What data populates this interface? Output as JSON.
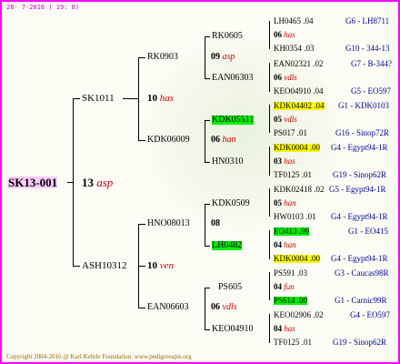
{
  "header": {
    "date": "28- 7-2016 ( 19: 8)"
  },
  "footer": {
    "copyright": "Copyright 2004-2016 @ Karl Kehrle Foundation.   www.pedigreeapis.org"
  },
  "root": {
    "name": "SK13-001",
    "number": "13",
    "year_code": "asp"
  },
  "gen2": [
    {
      "name": "SK1011"
    },
    {
      "name": "ASH10312"
    }
  ],
  "gen2_nums": [
    {
      "number": "10",
      "year_code": "has"
    },
    {
      "number": "10",
      "year_code": "ven"
    }
  ],
  "gen3": [
    {
      "name": "RK0903",
      "number": "09",
      "year_code": "asp"
    },
    {
      "name": "KDK06009",
      "number": "06",
      "year_code": "han"
    },
    {
      "name": "HNO08013",
      "number": "08",
      "year_code": ""
    },
    {
      "name": "EAN06603",
      "number": "06",
      "year_code": "vdls"
    }
  ],
  "gen4": [
    {
      "name": "RK0605",
      "number": "06",
      "year_code": "has"
    },
    {
      "name": "EAN06303",
      "number": "06",
      "year_code": "vdls"
    },
    {
      "name": "KDK05511",
      "number": "05",
      "year_code": "vdls"
    },
    {
      "name": "HN0310",
      "number": "03",
      "year_code": "has"
    },
    {
      "name": "KDK0509",
      "number": "05",
      "year_code": "han"
    },
    {
      "name": "LH0482",
      "number": "04",
      "year_code": "han"
    },
    {
      "name": "PS605",
      "number": "04",
      "year_code": "fun"
    },
    {
      "name": "KEO04910",
      "number": "04",
      "year_code": "has"
    }
  ],
  "gen5": [
    {
      "name": "LH0465 .04",
      "info": "G6 - LH8711"
    },
    {
      "name": "KH0354 .03",
      "info": "G10 - 344-13"
    },
    {
      "name": "EAN02321 .02",
      "info": "G7 - B-344?"
    },
    {
      "name": "KEO04910 .04",
      "info": "G5 - EO597"
    },
    {
      "name": "KDK04402 .04",
      "info": "G1 - KDK0103"
    },
    {
      "name": "PS017 .01",
      "info": "G16 - Sinop72R"
    },
    {
      "name": "KDK0004 .00",
      "info": "G4 - Egypt94-1R"
    },
    {
      "name": "TF0125 .01",
      "info": "G19 - Sinop62R"
    },
    {
      "name": "KDK02418 .02",
      "info": "G5 - Egypt94-1R"
    },
    {
      "name": "HW0103 .01",
      "info": "G4 - Egypt94-1R"
    },
    {
      "name": "EO413 .99",
      "info": "G1 - EO415"
    },
    {
      "name": "KDK0004 .00",
      "info": "G4 - Egypt94-1R"
    },
    {
      "name": "PS591 .03",
      "info": "G3 - Caucas98R"
    },
    {
      "name": "PS614 .00",
      "info": "G1 - Carnic99R"
    },
    {
      "name": "KEO02906 .02",
      "info": "G4 - EO597"
    },
    {
      "name": "TF0125 .01",
      "info": "G19 - Sinop62R"
    }
  ],
  "colors": {
    "border": "#ff00ff",
    "root_bg": "#ffccff",
    "highlight_yellow": "#ffff00",
    "highlight_green": "#00ee00",
    "year_red": "#cc0000",
    "info_blue": "#000099"
  }
}
